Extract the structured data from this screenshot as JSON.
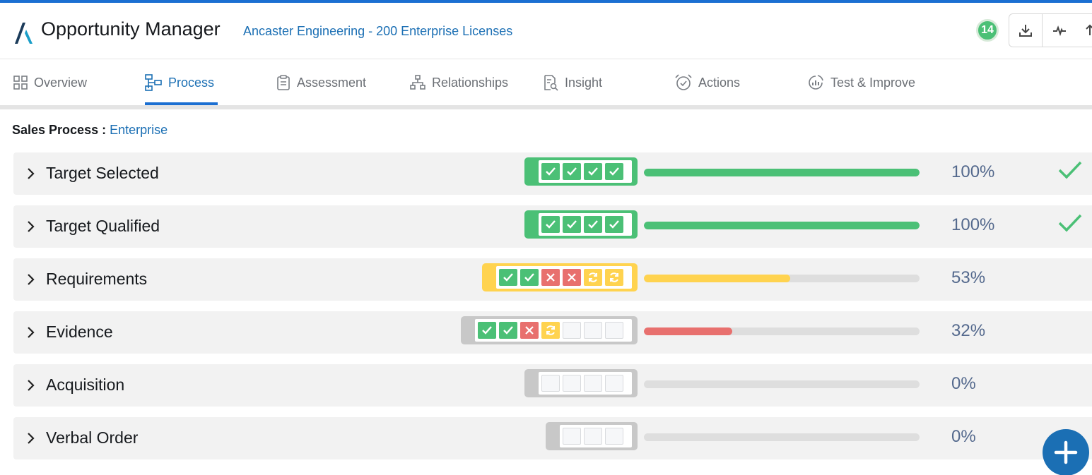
{
  "header": {
    "app_title": "Opportunity Manager",
    "record_title": "Ancaster Engineering - 200 Enterprise Licenses",
    "notification_count": "14"
  },
  "tabs": [
    {
      "label": "Overview",
      "icon": "grid-icon",
      "active": false
    },
    {
      "label": "Process",
      "icon": "process-flow-icon",
      "active": true
    },
    {
      "label": "Assessment",
      "icon": "clipboard-icon",
      "active": false
    },
    {
      "label": "Relationships",
      "icon": "org-chart-icon",
      "active": false
    },
    {
      "label": "Insight",
      "icon": "document-search-icon",
      "active": false
    },
    {
      "label": "Actions",
      "icon": "alarm-clock-icon",
      "active": false
    },
    {
      "label": "Test & Improve",
      "icon": "chart-circle-icon",
      "active": false
    }
  ],
  "process": {
    "label": "Sales Process :",
    "value": "Enterprise"
  },
  "stages": [
    {
      "name": "Target Selected",
      "percent": "100%",
      "progress": 1.0,
      "status": "complete",
      "steps": [
        "ok",
        "ok",
        "ok",
        "ok"
      ]
    },
    {
      "name": "Target Qualified",
      "percent": "100%",
      "progress": 1.0,
      "status": "complete",
      "steps": [
        "ok",
        "ok",
        "ok",
        "ok"
      ]
    },
    {
      "name": "Requirements",
      "percent": "53%",
      "progress": 0.53,
      "status": "in-progress",
      "steps": [
        "ok",
        "ok",
        "fail",
        "fail",
        "prog",
        "prog"
      ]
    },
    {
      "name": "Evidence",
      "percent": "32%",
      "progress": 0.32,
      "status": "at-risk",
      "steps": [
        "ok",
        "ok",
        "fail",
        "prog",
        "empty",
        "empty",
        "empty"
      ]
    },
    {
      "name": "Acquisition",
      "percent": "0%",
      "progress": 0,
      "status": "not-started",
      "steps": [
        "empty",
        "empty",
        "empty",
        "empty"
      ]
    },
    {
      "name": "Verbal Order",
      "percent": "0%",
      "progress": 0,
      "status": "not-started",
      "steps": [
        "empty",
        "empty",
        "empty"
      ]
    }
  ],
  "colors": {
    "accent": "#1b6fb4",
    "complete": "#4bc076",
    "in_progress": "#ffd34f",
    "at_risk": "#e8706e",
    "not_started": "#c8c8c8"
  }
}
